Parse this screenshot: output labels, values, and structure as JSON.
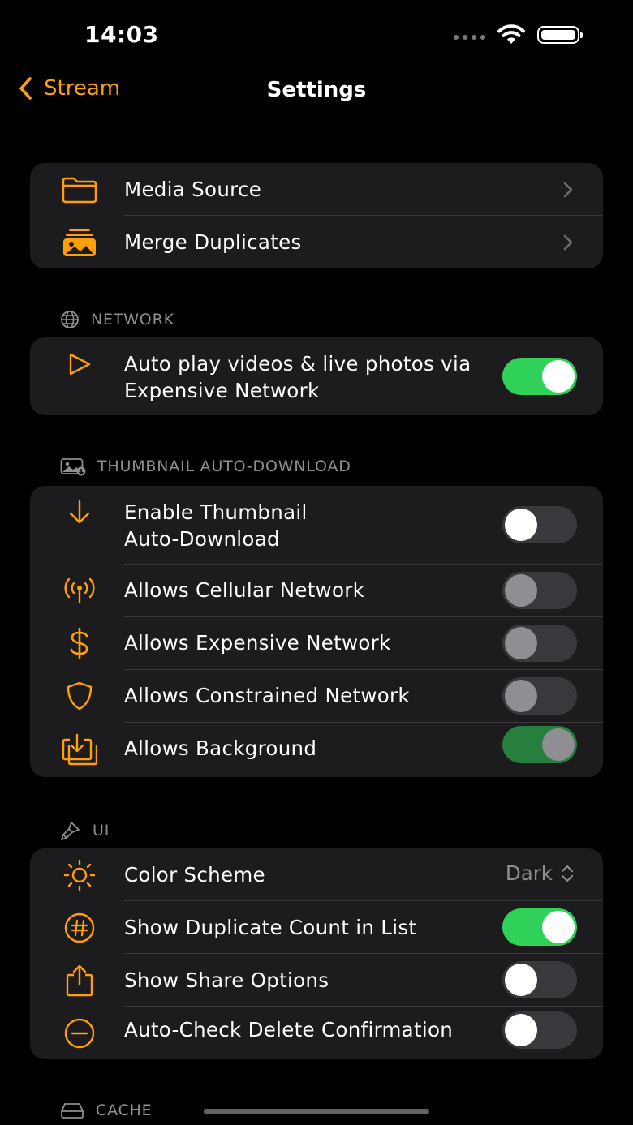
{
  "status_bar": {
    "time": "14:03"
  },
  "nav": {
    "back_label": "Stream",
    "title": "Settings"
  },
  "general": {
    "items": [
      {
        "label": "Media Source",
        "icon": "folder-icon"
      },
      {
        "label": "Merge Duplicates",
        "icon": "photos-stack-icon"
      }
    ]
  },
  "network": {
    "header": "NETWORK",
    "items": [
      {
        "label": "Auto play videos & live photos via Expensive Network",
        "icon": "play-icon",
        "on": true
      }
    ]
  },
  "thumbnail": {
    "header": "THUMBNAIL AUTO-DOWNLOAD",
    "items": [
      {
        "label": "Enable Thumbnail Auto-Download",
        "icon": "download-arrow-icon",
        "on": false
      },
      {
        "label": "Allows Cellular Network",
        "icon": "antenna-icon",
        "on": false
      },
      {
        "label": "Allows Expensive Network",
        "icon": "dollar-icon",
        "on": false
      },
      {
        "label": "Allows Constrained Network",
        "icon": "shield-icon",
        "on": false
      },
      {
        "label": "Allows Background",
        "icon": "tray-download-icon",
        "on": true
      }
    ]
  },
  "ui": {
    "header": "UI",
    "items": [
      {
        "label": "Color Scheme",
        "icon": "sun-icon",
        "value": "Dark"
      },
      {
        "label": "Show Duplicate Count in List",
        "icon": "number-circle-icon",
        "on": true
      },
      {
        "label": "Show Share Options",
        "icon": "share-icon",
        "on": false
      },
      {
        "label": "Auto-Check Delete Confirmation",
        "icon": "minus-circle-icon",
        "on": false
      }
    ]
  },
  "cache": {
    "header": "CACHE"
  },
  "colors": {
    "accent": "#ff9f0a",
    "toggle_on": "#30d158",
    "group_bg": "#1c1c1e"
  }
}
